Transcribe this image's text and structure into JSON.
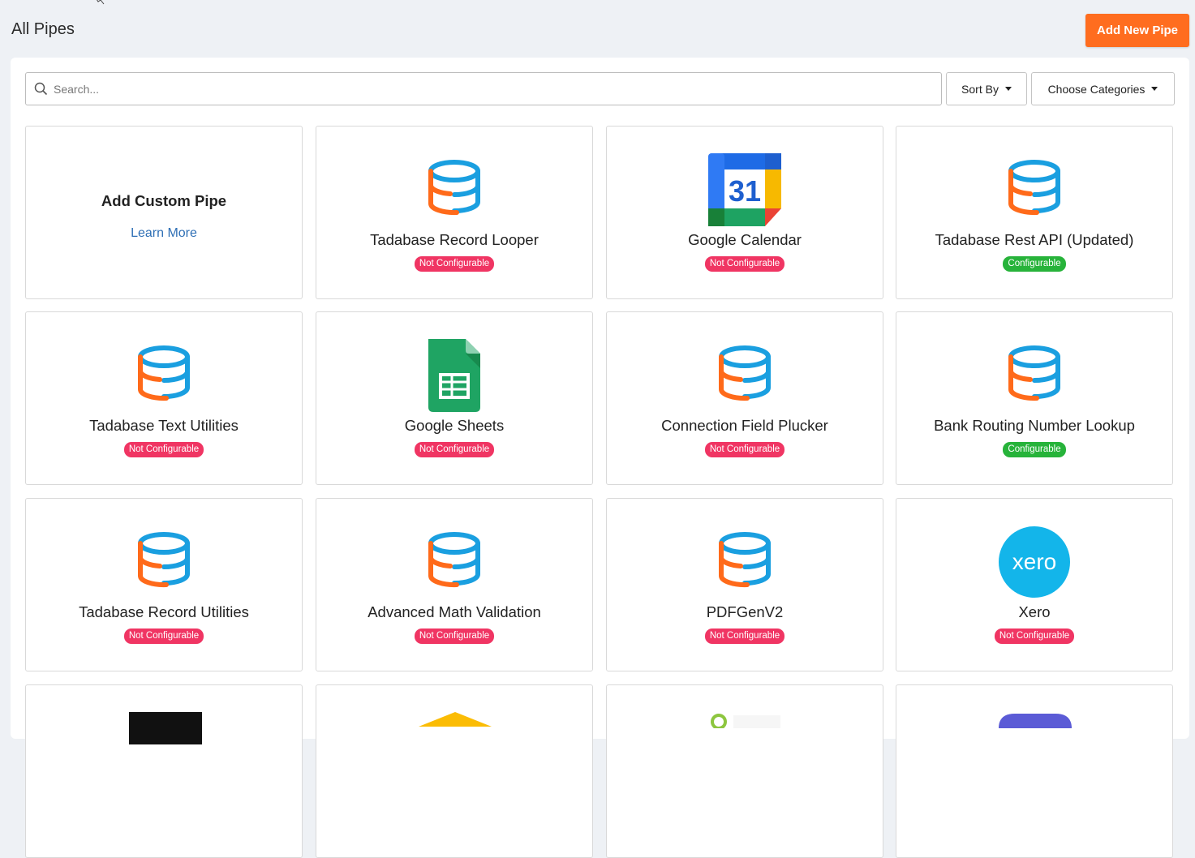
{
  "header": {
    "title": "All Pipes",
    "add_button": "Add New Pipe"
  },
  "toolbar": {
    "search_placeholder": "Search...",
    "sort_label": "Sort By",
    "categories_label": "Choose Categories"
  },
  "custom_card": {
    "title": "Add Custom Pipe",
    "link": "Learn More"
  },
  "pipes": [
    {
      "name": "Tadabase Record Looper",
      "icon": "database-icon",
      "status": "Not Configurable"
    },
    {
      "name": "Google Calendar",
      "icon": "google-calendar-icon",
      "status": "Not Configurable"
    },
    {
      "name": "Tadabase Rest API (Updated)",
      "icon": "database-icon",
      "status": "Configurable"
    },
    {
      "name": "Tadabase Text Utilities",
      "icon": "database-icon",
      "status": "Not Configurable"
    },
    {
      "name": "Google Sheets",
      "icon": "google-sheets-icon",
      "status": "Not Configurable"
    },
    {
      "name": "Connection Field Plucker",
      "icon": "database-icon",
      "status": "Not Configurable"
    },
    {
      "name": "Bank Routing Number Lookup",
      "icon": "database-icon",
      "status": "Configurable"
    },
    {
      "name": "Tadabase Record Utilities",
      "icon": "database-icon",
      "status": "Not Configurable"
    },
    {
      "name": "Advanced Math Validation",
      "icon": "database-icon",
      "status": "Not Configurable"
    },
    {
      "name": "PDFGenV2",
      "icon": "database-icon",
      "status": "Not Configurable"
    },
    {
      "name": "Xero",
      "icon": "xero-icon",
      "status": "Not Configurable"
    }
  ],
  "xero_logo_text": "xero",
  "calendar_day": "31",
  "colors": {
    "accent": "#ff6d1f",
    "not_configurable": "#f03563",
    "configurable": "#27b33a",
    "link": "#2e6fb5"
  }
}
